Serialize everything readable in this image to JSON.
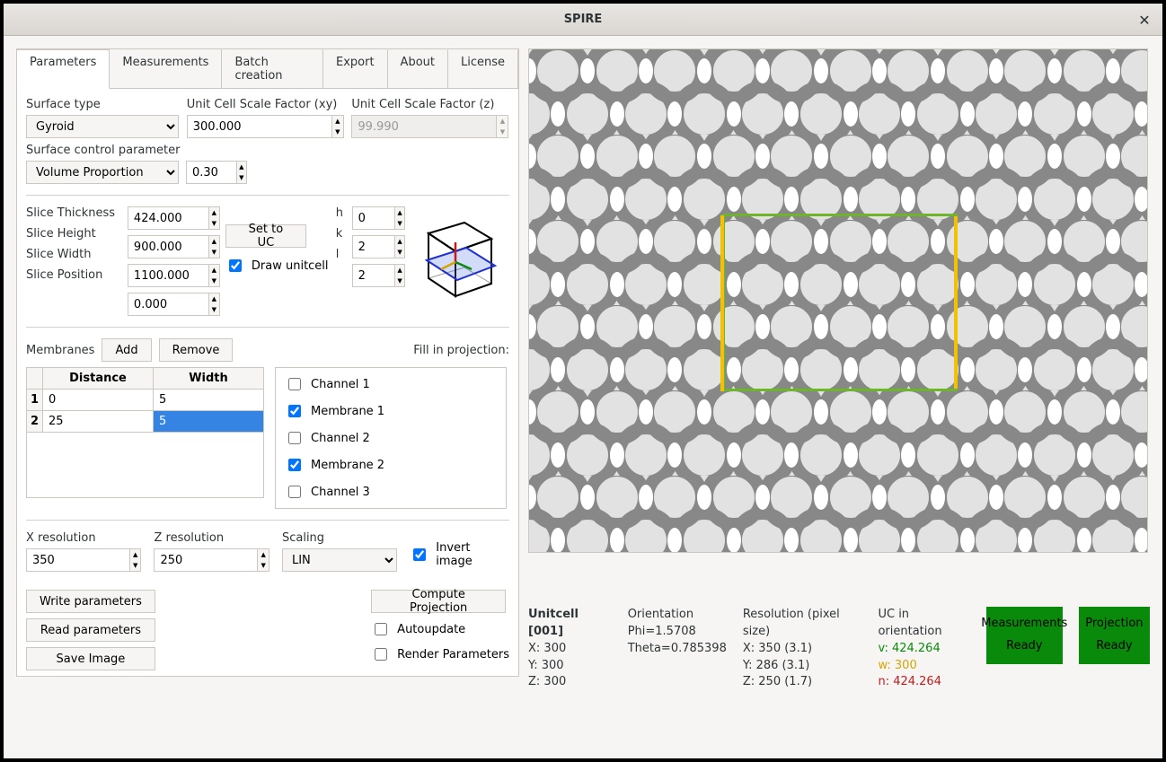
{
  "window": {
    "title": "SPIRE"
  },
  "tabs": [
    "Parameters",
    "Measurements",
    "Batch creation",
    "Export",
    "About",
    "License"
  ],
  "active_tab": 0,
  "surface": {
    "type_label": "Surface type",
    "type_value": "Gyroid",
    "uc_xy_label": "Unit Cell Scale Factor (xy)",
    "uc_xy_value": "300.000",
    "uc_z_label": "Unit Cell Scale Factor  (z)",
    "uc_z_value": "99.990",
    "ctrl_label": "Surface control parameter",
    "ctrl_type": "Volume Proportion",
    "ctrl_value": "0.30"
  },
  "slice": {
    "thickness_label": "Slice Thickness",
    "thickness": "424.000",
    "height_label": "Slice Height",
    "height": "900.000",
    "width_label": "Slice Width",
    "width": "1100.000",
    "position_label": "Slice Position",
    "position": "0.000",
    "set_to_uc": "Set to UC",
    "draw_unitcell_label": "Draw unitcell",
    "draw_unitcell": true,
    "h_label": "h",
    "h": "0",
    "k_label": "k",
    "k": "2",
    "l_label": "l",
    "l": "2"
  },
  "membranes": {
    "label": "Membranes",
    "add": "Add",
    "remove": "Remove",
    "fill_label": "Fill in projection:",
    "headers": [
      "Distance",
      "Width"
    ],
    "rows": [
      {
        "n": "1",
        "distance": "0",
        "width": "5",
        "sel": false
      },
      {
        "n": "2",
        "distance": "25",
        "width": "5",
        "sel": true
      }
    ],
    "channels": [
      {
        "label": "Channel 1",
        "checked": false
      },
      {
        "label": "Membrane 1",
        "checked": true
      },
      {
        "label": "Channel 2",
        "checked": false
      },
      {
        "label": "Membrane 2",
        "checked": true
      },
      {
        "label": "Channel 3",
        "checked": false
      }
    ]
  },
  "resolution": {
    "x_label": "X resolution",
    "x": "350",
    "z_label": "Z resolution",
    "z": "250",
    "scaling_label": "Scaling",
    "scaling": "LIN",
    "invert_label": "Invert image",
    "invert": true
  },
  "buttons": {
    "write": "Write parameters",
    "read": "Read parameters",
    "save": "Save Image",
    "compute": "Compute Projection",
    "autoupdate_label": "Autoupdate",
    "autoupdate": false,
    "render_label": "Render Parameters",
    "render": false
  },
  "status": {
    "unitcell_title": "Unitcell [001]",
    "uc_x": "X: 300",
    "uc_y": "Y: 300",
    "uc_z": "Z: 300",
    "orient_title": "Orientation",
    "phi": "Phi=1.5708",
    "theta": "Theta=0.785398",
    "res_title": "Resolution (pixel size)",
    "res_x": "X:   350 (3.1)",
    "res_y": "Y:   286 (3.1)",
    "res_z": "Z:   250 (1.7)",
    "uc_orient_title": "UC in orientation",
    "uc_v": "v: 424.264",
    "uc_w": "w: 300",
    "uc_n": "n: 424.264",
    "meas_title": "Measurements",
    "proj_title": "Projection",
    "ready": "Ready"
  }
}
